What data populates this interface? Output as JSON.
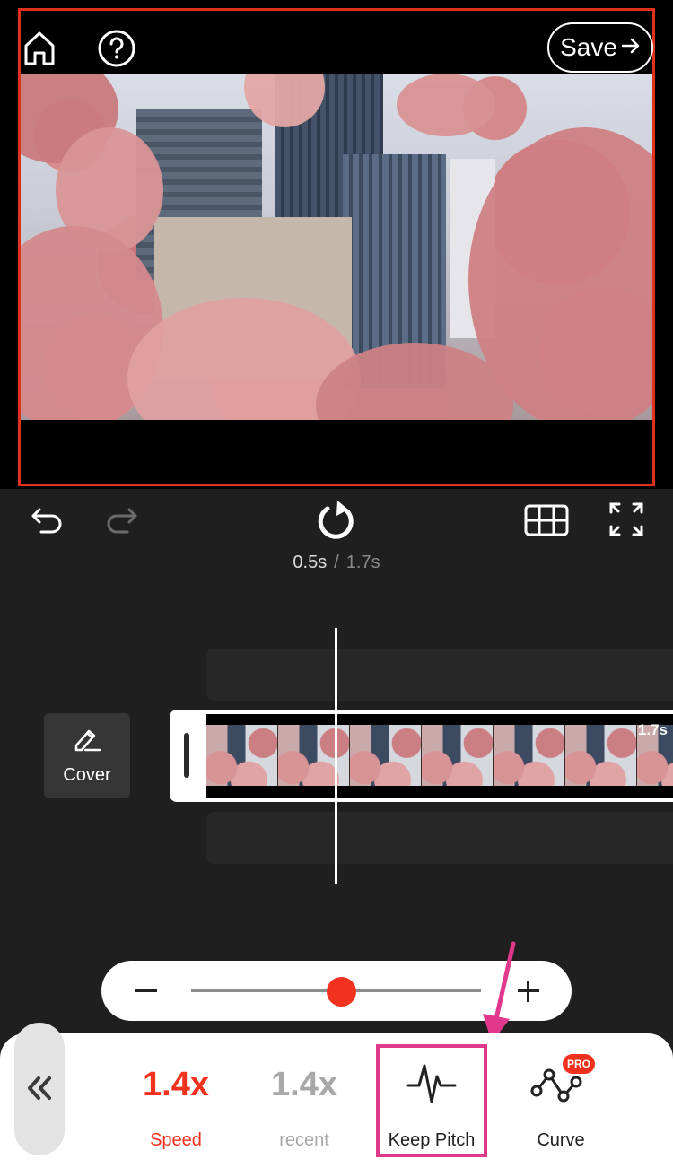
{
  "header": {
    "save_label": "Save"
  },
  "player": {
    "current_time": "0.5s",
    "separator": "/",
    "total_time": "1.7s"
  },
  "timeline": {
    "cover_label": "Cover",
    "clip_duration": "1.7s"
  },
  "speed_slider": {
    "value_fraction": 0.52
  },
  "options": {
    "speed": {
      "value": "1.4x",
      "label": "Speed"
    },
    "recent": {
      "value": "1.4x",
      "label": "recent"
    },
    "keep_pitch": {
      "label": "Keep Pitch"
    },
    "curve": {
      "label": "Curve",
      "badge": "PRO"
    }
  },
  "colors": {
    "accent": "#f2321e",
    "annotation": "#e0388b",
    "muted": "#a8a8a8"
  },
  "icons": [
    "home-icon",
    "help-icon",
    "arrow-right-icon",
    "undo-icon",
    "redo-icon",
    "replay-icon",
    "grid-icon",
    "fullscreen-icon",
    "pencil-icon",
    "double-chevron-left-icon",
    "waveform-icon",
    "curve-icon"
  ]
}
